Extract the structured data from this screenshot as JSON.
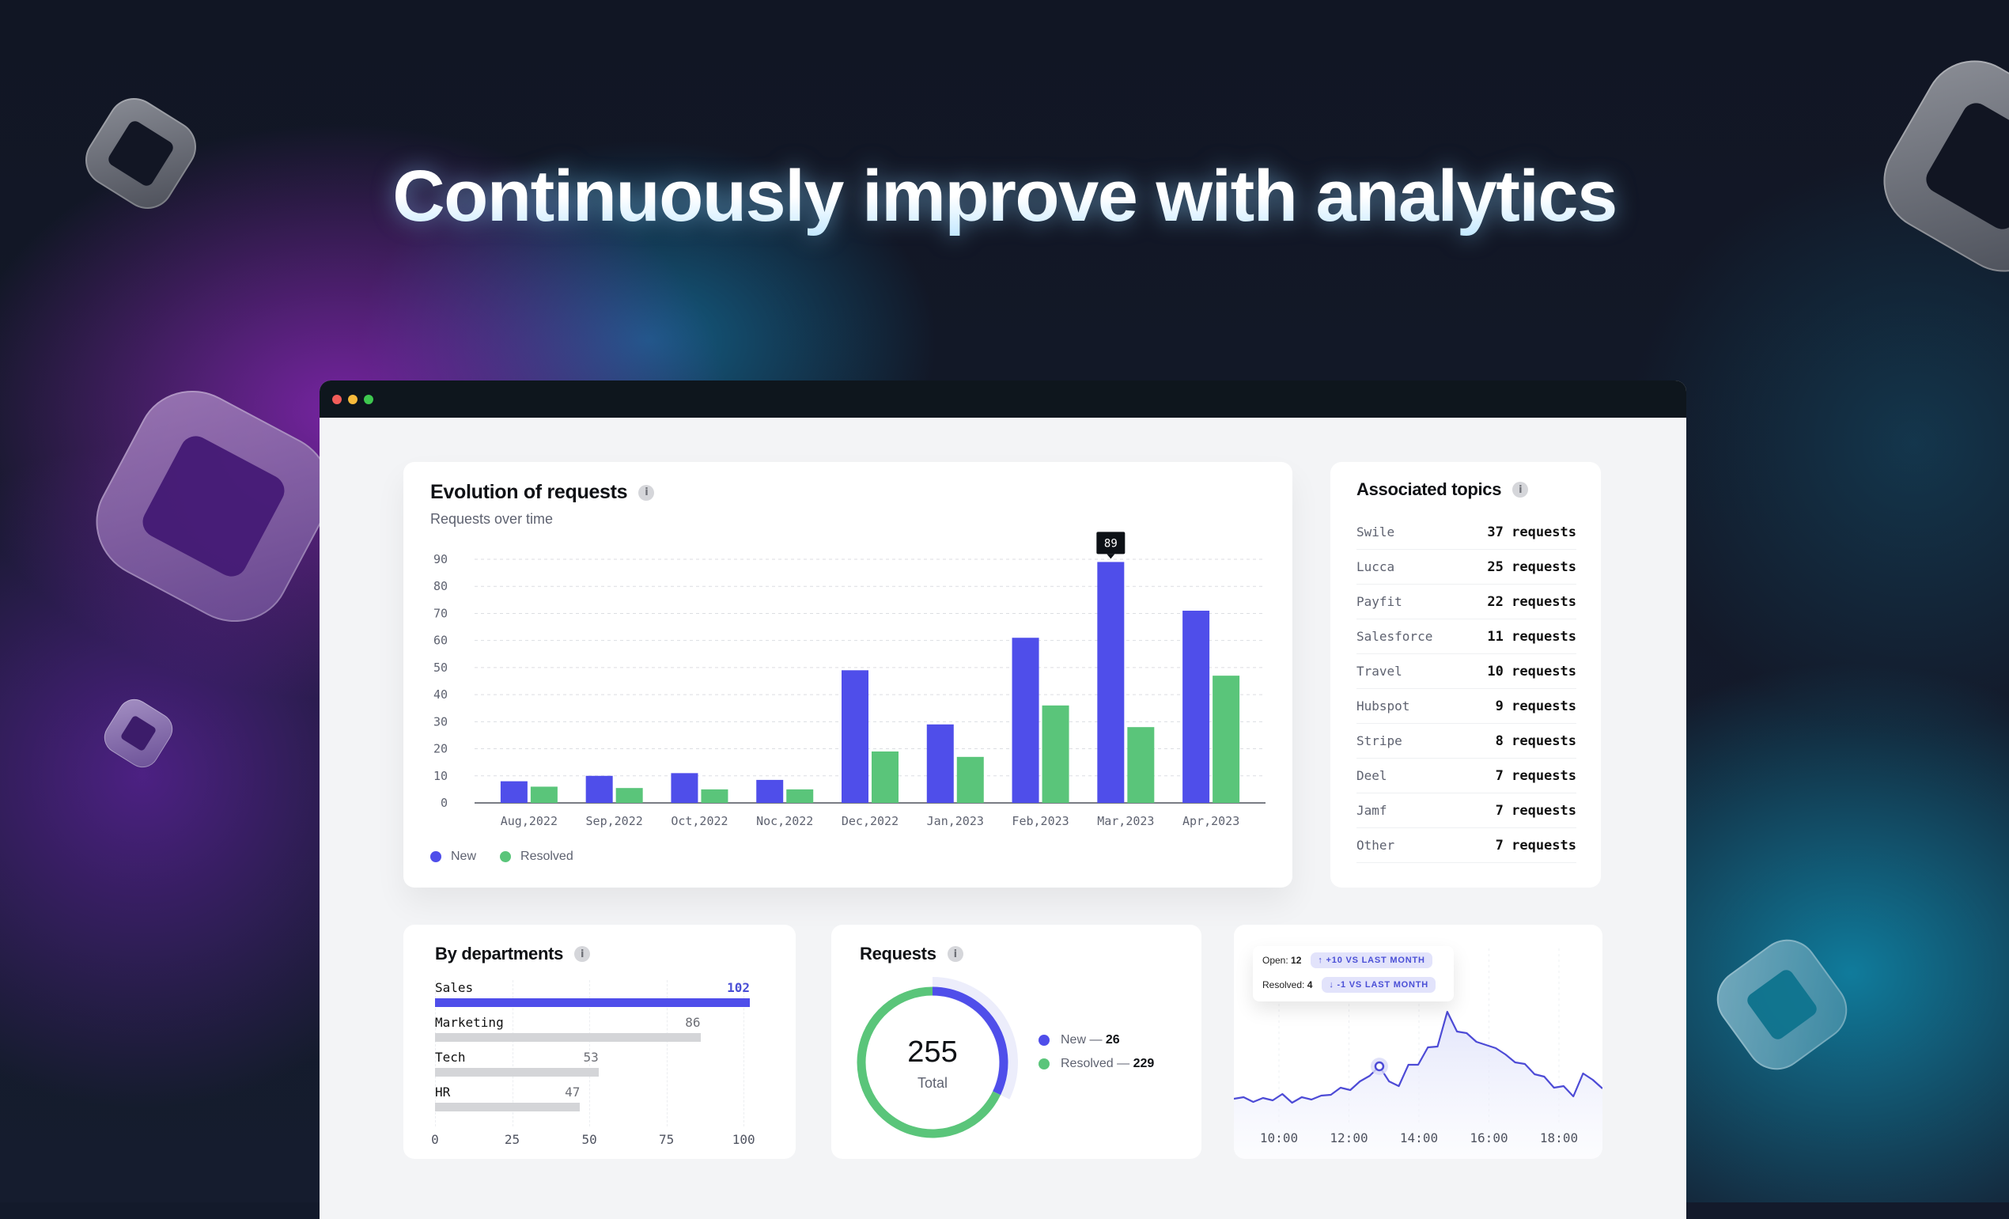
{
  "headline": "Continuously improve with analytics",
  "window": {
    "controls": [
      "close",
      "minimize",
      "maximize"
    ]
  },
  "colors": {
    "new": "#4f4eea",
    "resolved": "#5ac57a",
    "muted_bar": "#d4d5d8",
    "accent_text": "#4a4fd6"
  },
  "evolution": {
    "title": "Evolution of requests",
    "info_icon": "i",
    "subtitle": "Requests over time",
    "tooltip_value": "89",
    "legend": {
      "new": "New",
      "resolved": "Resolved"
    }
  },
  "chart_data": [
    {
      "type": "bar",
      "title": "Evolution of requests",
      "subtitle": "Requests over time",
      "categories": [
        "Aug,2022",
        "Sep,2022",
        "Oct,2022",
        "Noc,2022",
        "Dec,2022",
        "Jan,2023",
        "Feb,2023",
        "Mar,2023",
        "Apr,2023"
      ],
      "series": [
        {
          "name": "New",
          "values": [
            8,
            10,
            11,
            8.5,
            49,
            29,
            61,
            89,
            71
          ]
        },
        {
          "name": "Resolved",
          "values": [
            6,
            5.5,
            5,
            5,
            19,
            17,
            36,
            28,
            47
          ]
        }
      ],
      "yticks": [
        0,
        10,
        20,
        30,
        40,
        50,
        60,
        70,
        80,
        90
      ],
      "ylim": [
        0,
        90
      ],
      "grid": true,
      "legend_position": "bottom-left",
      "annotation": {
        "category": "Mar,2023",
        "series": "New",
        "label": "89"
      }
    },
    {
      "type": "bar",
      "orientation": "horizontal",
      "title": "By departments",
      "categories": [
        "Sales",
        "Marketing",
        "Tech",
        "HR"
      ],
      "values": [
        102,
        86,
        53,
        47
      ],
      "highlight": "Sales",
      "xticks": [
        0,
        25,
        50,
        75,
        100
      ],
      "xlim": [
        0,
        102
      ]
    },
    {
      "type": "pie",
      "variant": "donut",
      "title": "Requests",
      "total": 255,
      "total_label": "Total",
      "slices": [
        {
          "name": "New",
          "value": 26
        },
        {
          "name": "Resolved",
          "value": 229
        }
      ]
    },
    {
      "type": "area",
      "xticks": [
        "10:00",
        "12:00",
        "14:00",
        "16:00",
        "18:00"
      ],
      "x": [
        "9:30",
        "9:45",
        "10:00",
        "10:15",
        "10:30",
        "10:45",
        "11:00",
        "11:15",
        "11:30",
        "11:45",
        "12:00",
        "12:15",
        "12:30",
        "12:45",
        "13:00",
        "13:15",
        "13:30",
        "13:45",
        "14:00",
        "14:15",
        "14:30",
        "14:45",
        "15:00",
        "15:15",
        "15:30",
        "15:45",
        "16:00",
        "16:15",
        "16:30",
        "16:45",
        "17:00",
        "17:15",
        "17:30",
        "17:45",
        "18:00",
        "18:15",
        "18:30",
        "18:45",
        "19:00"
      ],
      "values": [
        3,
        3.2,
        2.6,
        3.1,
        2.8,
        3.6,
        2.5,
        3.2,
        2.9,
        3.4,
        3.5,
        4.4,
        4.1,
        5.2,
        5.9,
        7.1,
        5.2,
        4.6,
        7.3,
        7.3,
        9.5,
        9.6,
        14,
        11.5,
        11.3,
        10.2,
        9.8,
        9.4,
        8.6,
        7.6,
        7.4,
        6.1,
        5.8,
        4.4,
        4.6,
        3.3,
        6.2,
        5.4,
        4.3
      ],
      "highlight_point": {
        "x": "13:15",
        "value": 7.1
      },
      "tooltip": {
        "open_label": "Open:",
        "open_value": "12",
        "open_delta": "+10 VS LAST MONTH",
        "open_dir": "up",
        "resolved_label": "Resolved:",
        "resolved_value": "4",
        "resolved_delta": "-1 VS LAST MONTH",
        "resolved_dir": "down"
      }
    }
  ],
  "topics": {
    "title": "Associated topics",
    "info_icon": "i",
    "items": [
      {
        "name": "Swile",
        "value": "37 requests"
      },
      {
        "name": "Lucca",
        "value": "25 requests"
      },
      {
        "name": "Payfit",
        "value": "22 requests"
      },
      {
        "name": "Salesforce",
        "value": "11 requests"
      },
      {
        "name": "Travel",
        "value": "10 requests"
      },
      {
        "name": "Hubspot",
        "value": " 9 requests"
      },
      {
        "name": "Stripe",
        "value": " 8 requests"
      },
      {
        "name": "Deel",
        "value": " 7 requests"
      },
      {
        "name": "Jamf",
        "value": " 7 requests"
      },
      {
        "name": "Other",
        "value": " 7 requests"
      }
    ]
  },
  "departments": {
    "title": "By departments",
    "info_icon": "i"
  },
  "requests": {
    "title": "Requests",
    "info_icon": "i",
    "total": "255",
    "total_label": "Total",
    "legend_new_label": "New —",
    "legend_new_value": "26",
    "legend_resolved_label": "Resolved —",
    "legend_resolved_value": "229"
  },
  "trend": {
    "open_label": "Open:",
    "open_value": "12",
    "open_delta": "↑ +10 VS LAST MONTH",
    "resolved_label": "Resolved:",
    "resolved_value": "4",
    "resolved_delta": "↓ -1 VS LAST MONTH"
  }
}
